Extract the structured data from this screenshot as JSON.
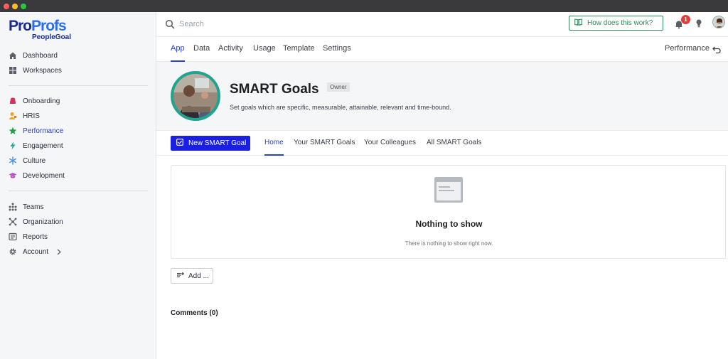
{
  "brand": {
    "logo_pro": "Pro",
    "logo_profs": "Profs",
    "logo_sub": "PeopleGoal"
  },
  "sidebar": {
    "items": [
      {
        "label": "Dashboard",
        "icon": "home-icon"
      },
      {
        "label": "Workspaces",
        "icon": "grid-icon"
      },
      {
        "label": "Onboarding",
        "icon": "onboarding-icon"
      },
      {
        "label": "HRIS",
        "icon": "hris-icon"
      },
      {
        "label": "Performance",
        "icon": "star-icon"
      },
      {
        "label": "Engagement",
        "icon": "bolt-icon"
      },
      {
        "label": "Culture",
        "icon": "snowflake-icon"
      },
      {
        "label": "Development",
        "icon": "graduation-cap-icon"
      },
      {
        "label": "Teams",
        "icon": "teams-icon"
      },
      {
        "label": "Organization",
        "icon": "org-icon"
      },
      {
        "label": "Reports",
        "icon": "reports-icon"
      },
      {
        "label": "Account",
        "icon": "gear-icon"
      }
    ],
    "active": "Performance"
  },
  "topbar": {
    "search_placeholder": "Search",
    "help_button": "How does this work?",
    "notification_count": "1"
  },
  "tabs": [
    "App",
    "Data",
    "Activity",
    "Usage",
    "Template",
    "Settings"
  ],
  "active_tab": "App",
  "performance_link": "Performance",
  "app": {
    "title": "SMART Goals",
    "owner_badge": "Owner",
    "description": "Set goals which are specific, measurable, attainable, relevant and time-bound."
  },
  "subnav": {
    "new_button": "New SMART Goal",
    "tabs": [
      "Home",
      "Your SMART Goals",
      "Your Colleagues",
      "All SMART Goals"
    ],
    "active": "Home"
  },
  "empty_state": {
    "title": "Nothing to show",
    "subtitle": "There is nothing to show right now."
  },
  "add_button": "Add ...",
  "comments_label": "Comments (0)",
  "colors": {
    "accent": "#2b3fd1",
    "primary_button": "#1a1fe0",
    "help_green": "#2e8b57",
    "badge_red": "#e23b3b",
    "avatar_ring": "#1fa58f"
  }
}
